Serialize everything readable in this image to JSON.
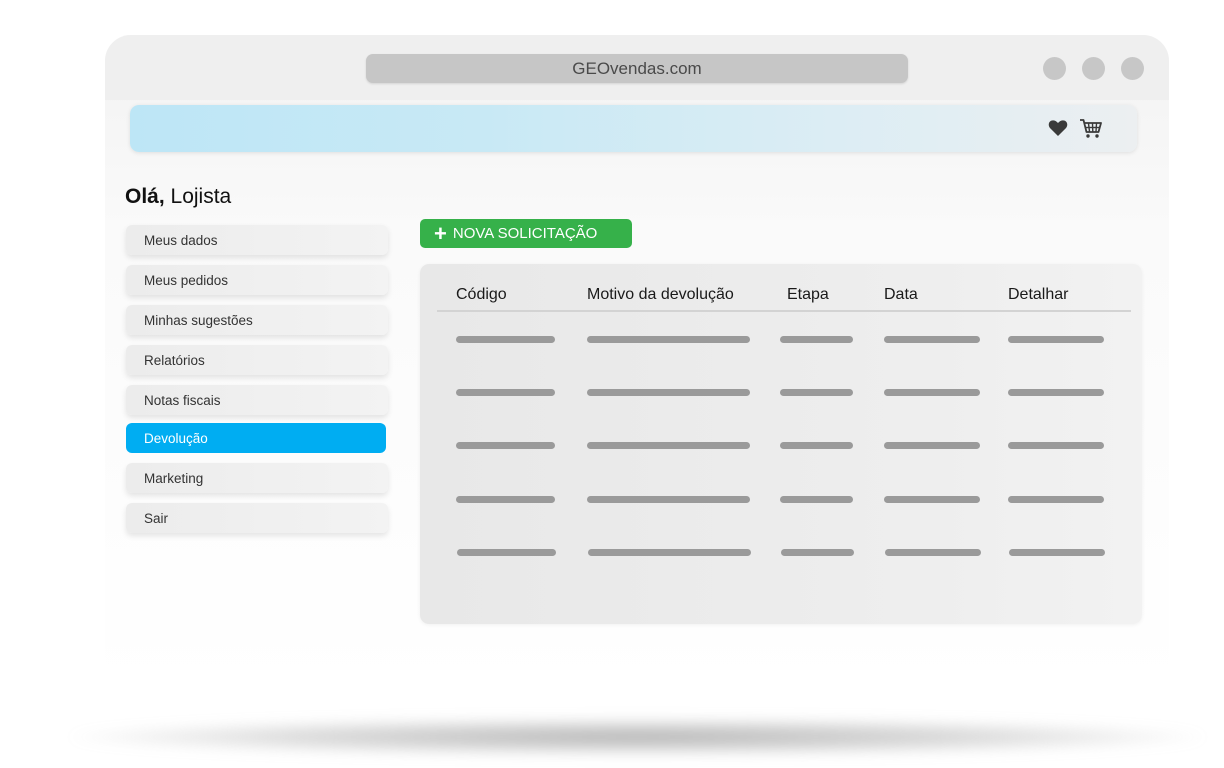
{
  "browser": {
    "url": "GEOvendas.com"
  },
  "header": {
    "icons": [
      "heart-icon",
      "cart-icon"
    ]
  },
  "greeting": {
    "bold": "Olá,",
    "name": "Lojista"
  },
  "sidebar": {
    "items": [
      {
        "label": "Meus dados"
      },
      {
        "label": "Meus pedidos"
      },
      {
        "label": "Minhas sugestões"
      },
      {
        "label": "Relatórios"
      },
      {
        "label": "Notas fiscais"
      },
      {
        "label": "Devolução",
        "active": true
      },
      {
        "label": "Marketing"
      },
      {
        "label": "Sair"
      }
    ]
  },
  "actions": {
    "new_request_label": "NOVA SOLICITAÇÃO"
  },
  "table": {
    "columns": [
      "Código",
      "Motivo da devolução",
      "Etapa",
      "Data",
      "Detalhar"
    ]
  },
  "colors": {
    "active_menu": "#00adf2",
    "primary_button": "#36b14a",
    "header_band": "#bde6f6"
  }
}
